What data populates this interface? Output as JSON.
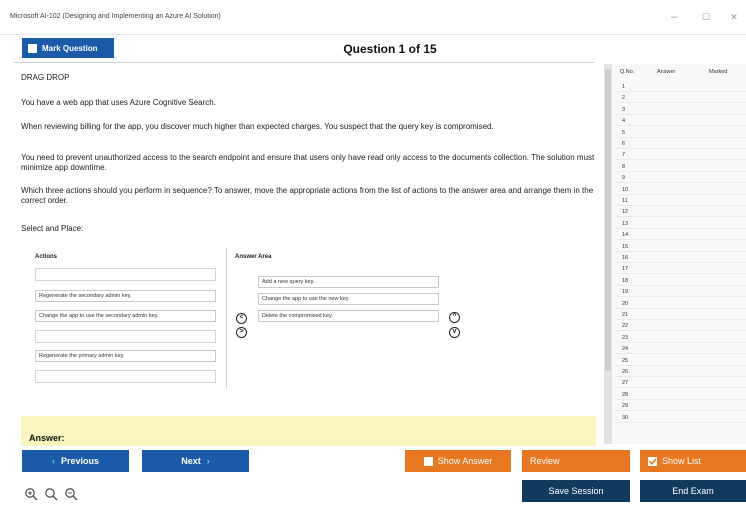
{
  "window": {
    "title": "Microsoft AI-102 (Designing and Implementing an Azure AI Solution)",
    "min": "–",
    "max": "☐",
    "close": "✕"
  },
  "header": {
    "mark_label": "Mark Question",
    "question_title": "Question 1 of 15"
  },
  "question": {
    "type": "DRAG DROP",
    "p1": "You have a web app that uses Azure Cognitive Search.",
    "p2": "When reviewing billing for the app, you discover much higher than expected charges. You suspect that the query key is compromised.",
    "p3": "You need to prevent unauthorized access to the search endpoint and ensure that users only have read only access to the documents collection. The solution must minimize app downtime.",
    "p4": "Which three actions should you perform in sequence? To answer, move the appropriate actions from the list of actions to the answer area and arrange them in the correct order.",
    "p5": "Select and Place:"
  },
  "dragdrop": {
    "actions_header": "Actions",
    "answer_header": "Answer Area",
    "actions": [
      "",
      "Regenerate the secondary admin key.",
      "Change the app to use the secondary admin key.",
      "",
      "Regenerate the primary admin key.",
      ""
    ],
    "answers": [
      "Add a new query key.",
      "Change the app to use the new key.",
      "Delete the compromised key."
    ],
    "move_left": "<",
    "move_right": ">",
    "move_up": "^",
    "move_down": "v"
  },
  "answer_label": "Answer:",
  "list_panel": {
    "headers": {
      "qno": "Q.No.",
      "answer": "Answer",
      "marked": "Marked"
    },
    "rows": [
      "1",
      "2",
      "3",
      "4",
      "5",
      "6",
      "7",
      "8",
      "9",
      "10",
      "11",
      "12",
      "13",
      "14",
      "15",
      "16",
      "17",
      "18",
      "19",
      "20",
      "21",
      "22",
      "23",
      "24",
      "25",
      "26",
      "27",
      "28",
      "29",
      "30"
    ]
  },
  "footer": {
    "previous": "Previous",
    "next": "Next",
    "show_answer": "Show Answer",
    "review": "Review",
    "show_list": "Show List",
    "save_session": "Save Session",
    "end_exam": "End Exam"
  },
  "colors": {
    "primary_blue": "#1a5aa8",
    "orange": "#e87722",
    "navy": "#123a5f",
    "answer_band": "#fbf5c0"
  }
}
